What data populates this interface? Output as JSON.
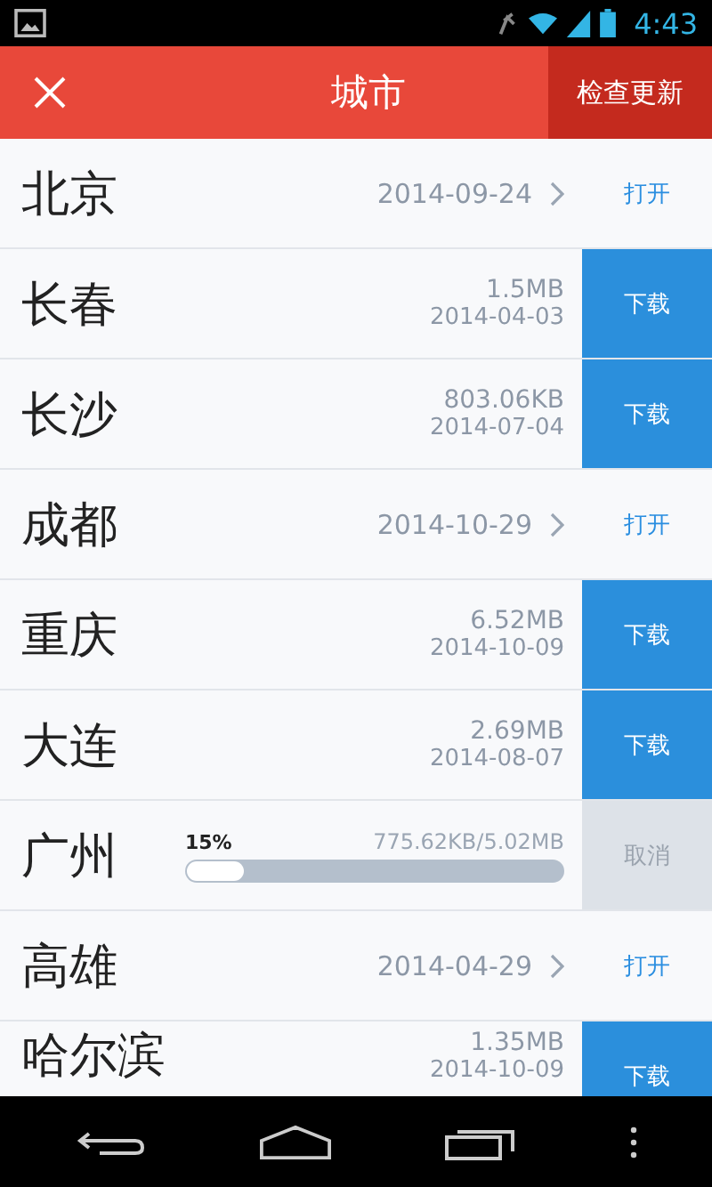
{
  "status_bar": {
    "time": "4:43"
  },
  "header": {
    "title": "城市",
    "action": "检查更新"
  },
  "cities": [
    {
      "kind": "open",
      "name": "北京",
      "date": "2014-09-24",
      "button": "打开"
    },
    {
      "kind": "download",
      "name": "长春",
      "size": "1.5MB",
      "date": "2014-04-03",
      "button": "下载"
    },
    {
      "kind": "download",
      "name": "长沙",
      "size": "803.06KB",
      "date": "2014-07-04",
      "button": "下载"
    },
    {
      "kind": "open",
      "name": "成都",
      "date": "2014-10-29",
      "button": "打开"
    },
    {
      "kind": "download",
      "name": "重庆",
      "size": "6.52MB",
      "date": "2014-10-09",
      "button": "下载"
    },
    {
      "kind": "download",
      "name": "大连",
      "size": "2.69MB",
      "date": "2014-08-07",
      "button": "下载"
    },
    {
      "kind": "progress",
      "name": "广州",
      "percent": "15%",
      "progress": "775.62KB/5.02MB",
      "level": 0.15,
      "button": "取消"
    },
    {
      "kind": "open",
      "name": "高雄",
      "date": "2014-04-29",
      "button": "打开"
    },
    {
      "kind": "download",
      "name": "哈尔滨",
      "size": "1.35MB",
      "date": "2014-10-09",
      "button": "下载"
    }
  ]
}
